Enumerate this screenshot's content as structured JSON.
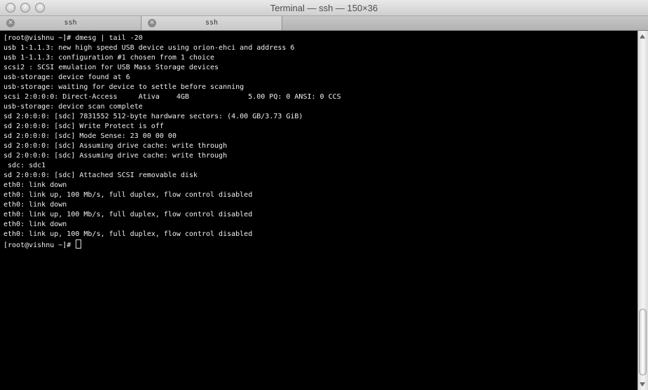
{
  "window": {
    "title": "Terminal — ssh — 150×36"
  },
  "tabs": [
    {
      "label": "ssh"
    },
    {
      "label": "ssh"
    }
  ],
  "icons": {
    "tab_close": "close-icon"
  },
  "terminal": {
    "lines": [
      "[root@vishnu ~]# dmesg | tail -20",
      "usb 1-1.1.3: new high speed USB device using orion-ehci and address 6",
      "usb 1-1.1.3: configuration #1 chosen from 1 choice",
      "scsi2 : SCSI emulation for USB Mass Storage devices",
      "usb-storage: device found at 6",
      "usb-storage: waiting for device to settle before scanning",
      "scsi 2:0:0:0: Direct-Access     Ativa    4GB              5.00 PQ: 0 ANSI: 0 CCS",
      "usb-storage: device scan complete",
      "sd 2:0:0:0: [sdc] 7831552 512-byte hardware sectors: (4.00 GB/3.73 GiB)",
      "sd 2:0:0:0: [sdc] Write Protect is off",
      "sd 2:0:0:0: [sdc] Mode Sense: 23 00 00 00",
      "sd 2:0:0:0: [sdc] Assuming drive cache: write through",
      "sd 2:0:0:0: [sdc] Assuming drive cache: write through",
      " sdc: sdc1",
      "sd 2:0:0:0: [sdc] Attached SCSI removable disk",
      "eth0: link down",
      "eth0: link up, 100 Mb/s, full duplex, flow control disabled",
      "eth0: link down",
      "eth0: link up, 100 Mb/s, full duplex, flow control disabled",
      "eth0: link down",
      "eth0: link up, 100 Mb/s, full duplex, flow control disabled"
    ],
    "prompt": "[root@vishnu ~]# "
  }
}
